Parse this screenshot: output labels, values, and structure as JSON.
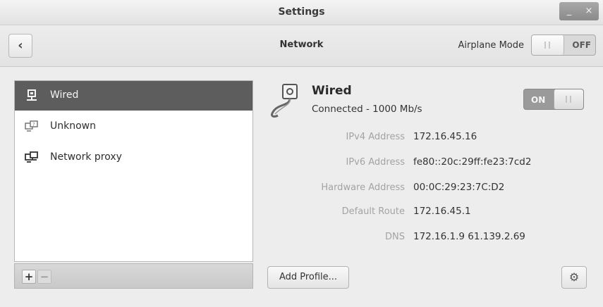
{
  "window": {
    "title": "Settings",
    "minimize_glyph": "_",
    "close_glyph": "×"
  },
  "header": {
    "back_glyph": "‹",
    "title": "Network",
    "airplane_label": "Airplane Mode",
    "airplane_state": "OFF"
  },
  "devices": [
    {
      "label": "Wired",
      "icon": "wired-network-icon",
      "selected": true
    },
    {
      "label": "Unknown",
      "icon": "network-unknown-icon",
      "selected": false
    },
    {
      "label": "Network proxy",
      "icon": "network-proxy-icon",
      "selected": false
    }
  ],
  "list_toolbar": {
    "add": "+",
    "remove": "−"
  },
  "detail": {
    "title": "Wired",
    "status": "Connected - 1000 Mb/s",
    "switch_state": "ON",
    "properties": [
      {
        "label": "IPv4 Address",
        "value": "172.16.45.16"
      },
      {
        "label": "IPv6 Address",
        "value": "fe80::20c:29ff:fe23:7cd2"
      },
      {
        "label": "Hardware Address",
        "value": "00:0C:29:23:7C:D2"
      },
      {
        "label": "Default Route",
        "value": "172.16.45.1"
      },
      {
        "label": "DNS",
        "value": "172.16.1.9 61.139.2.69"
      }
    ],
    "add_profile": "Add Profile...",
    "settings_icon": "gear-icon"
  }
}
